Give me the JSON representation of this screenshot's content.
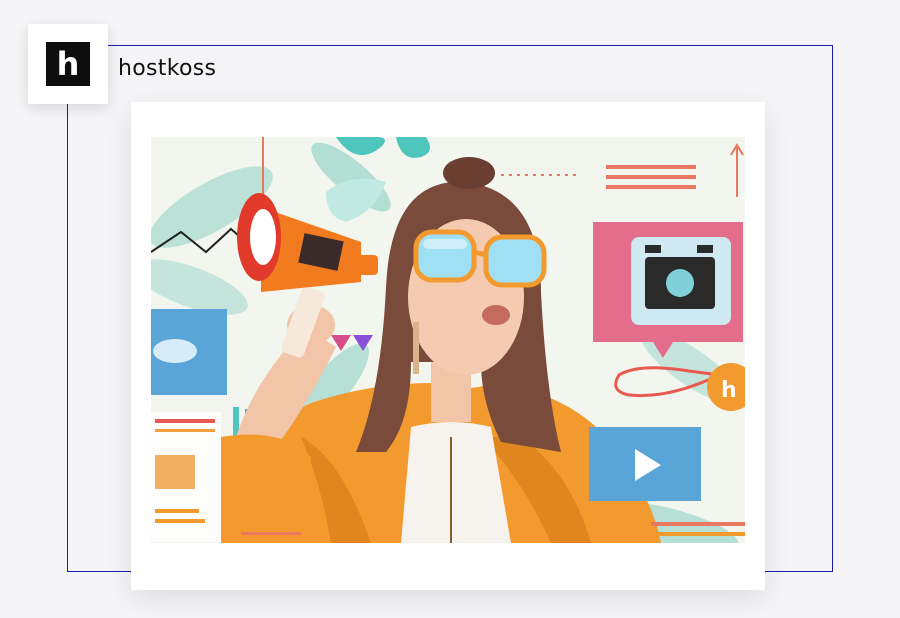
{
  "brand": {
    "logo_letter": "h",
    "name": "hostkoss"
  },
  "colors": {
    "frame_border": "#1c1cb0",
    "logo_bg": "#0e0e0e",
    "accent_orange": "#f29a2e",
    "accent_pink": "#e36d8a",
    "accent_blue": "#5aa5d8",
    "teal_leaves": "#6fc7b8"
  },
  "illustration": {
    "icons": [
      "megaphone-icon",
      "camera-icon",
      "play-icon",
      "chat-bubble-icon",
      "sunglasses-icon"
    ]
  }
}
